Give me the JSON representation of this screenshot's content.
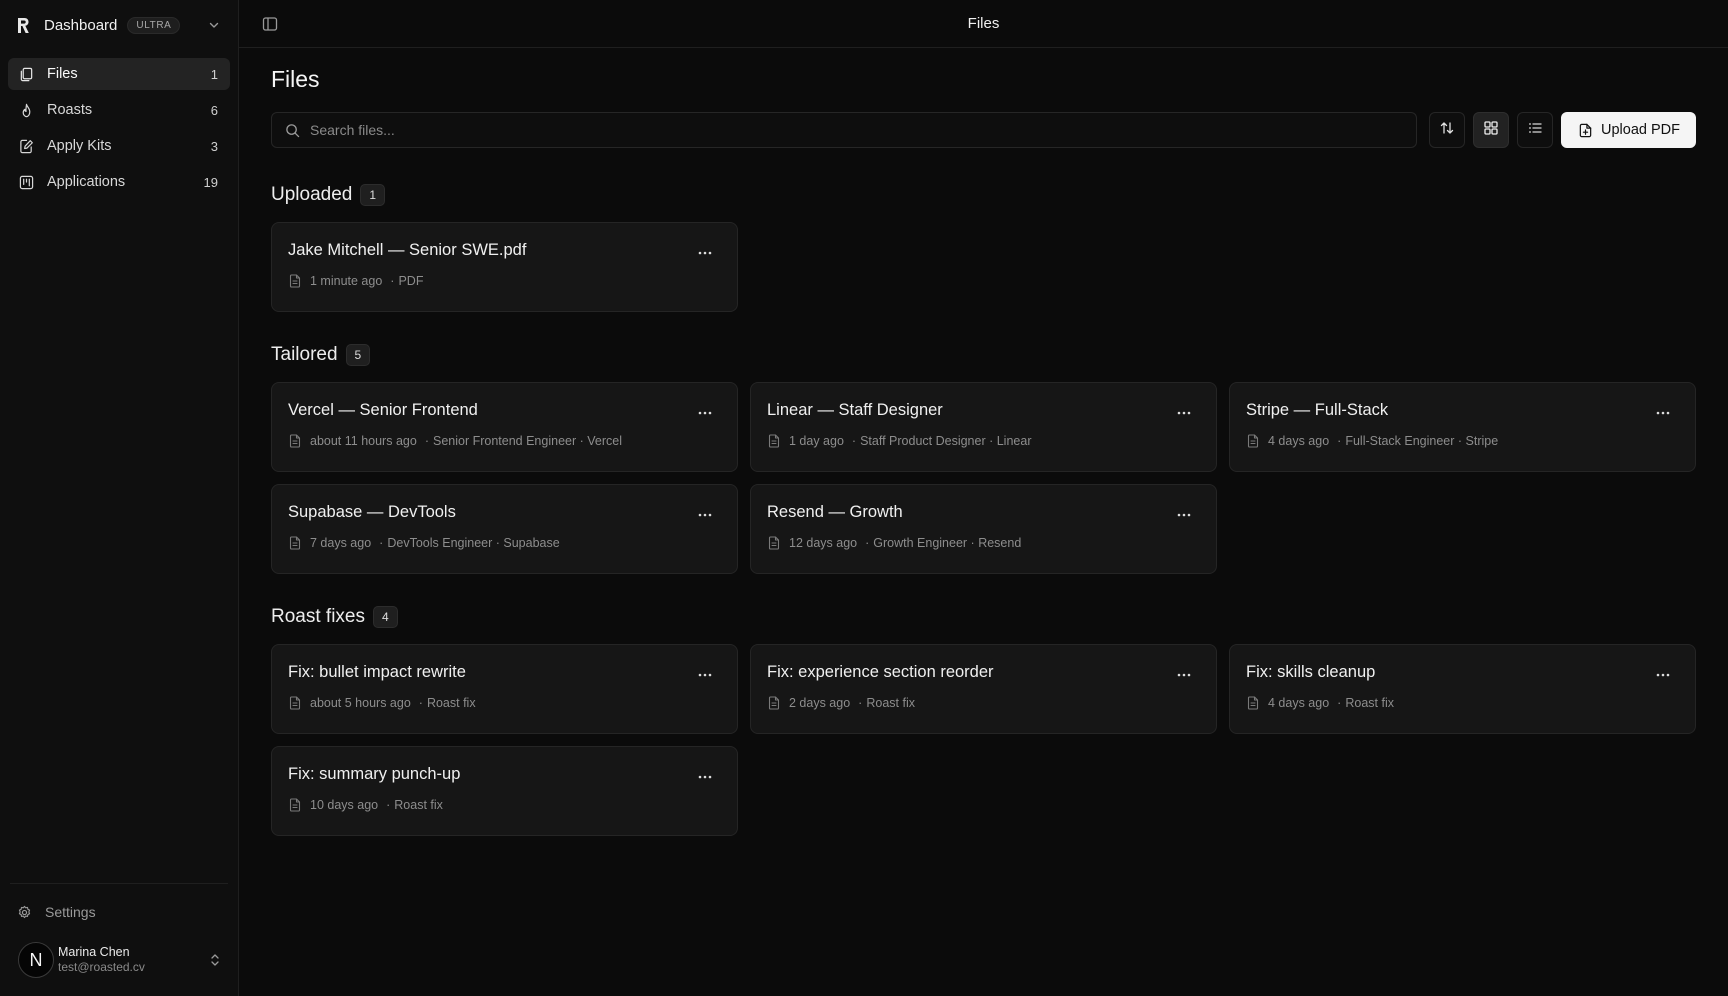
{
  "app": {
    "name": "Dashboard",
    "plan": "ULTRA"
  },
  "sidebar": {
    "items": [
      {
        "label": "Files",
        "count": "1",
        "icon": "files-icon",
        "active": true
      },
      {
        "label": "Roasts",
        "count": "6",
        "icon": "flame-icon"
      },
      {
        "label": "Apply Kits",
        "count": "3",
        "icon": "edit-doc-icon"
      },
      {
        "label": "Applications",
        "count": "19",
        "icon": "kanban-icon"
      }
    ],
    "settings_label": "Settings",
    "user": {
      "initial": "N",
      "name": "Marina Chen",
      "email": "test@roasted.cv"
    }
  },
  "topbar": {
    "title": "Files"
  },
  "page": {
    "title": "Files",
    "search_placeholder": "Search files...",
    "upload_label": "Upload PDF"
  },
  "sections": [
    {
      "title": "Uploaded",
      "count": "1",
      "cards": [
        {
          "title": "Jake Mitchell — Senior SWE.pdf",
          "time": "1 minute ago",
          "detail": "PDF"
        }
      ]
    },
    {
      "title": "Tailored",
      "count": "5",
      "cards": [
        {
          "title": "Vercel — Senior Frontend",
          "time": "about 11 hours ago",
          "detail": "Senior Frontend Engineer · Vercel"
        },
        {
          "title": "Linear — Staff Designer",
          "time": "1 day ago",
          "detail": "Staff Product Designer · Linear"
        },
        {
          "title": "Stripe — Full-Stack",
          "time": "4 days ago",
          "detail": "Full-Stack Engineer · Stripe"
        },
        {
          "title": "Supabase — DevTools",
          "time": "7 days ago",
          "detail": "DevTools Engineer · Supabase"
        },
        {
          "title": "Resend — Growth",
          "time": "12 days ago",
          "detail": "Growth Engineer · Resend"
        }
      ]
    },
    {
      "title": "Roast fixes",
      "count": "4",
      "cards": [
        {
          "title": "Fix: bullet impact rewrite",
          "time": "about 5 hours ago",
          "detail": "Roast fix"
        },
        {
          "title": "Fix: experience section reorder",
          "time": "2 days ago",
          "detail": "Roast fix"
        },
        {
          "title": "Fix: skills cleanup",
          "time": "4 days ago",
          "detail": "Roast fix"
        },
        {
          "title": "Fix: summary punch-up",
          "time": "10 days ago",
          "detail": "Roast fix"
        }
      ]
    }
  ],
  "colors": {
    "background": "#0b0b0b",
    "card": "#161616",
    "border": "#252525",
    "accent": "#f5f5f5"
  }
}
